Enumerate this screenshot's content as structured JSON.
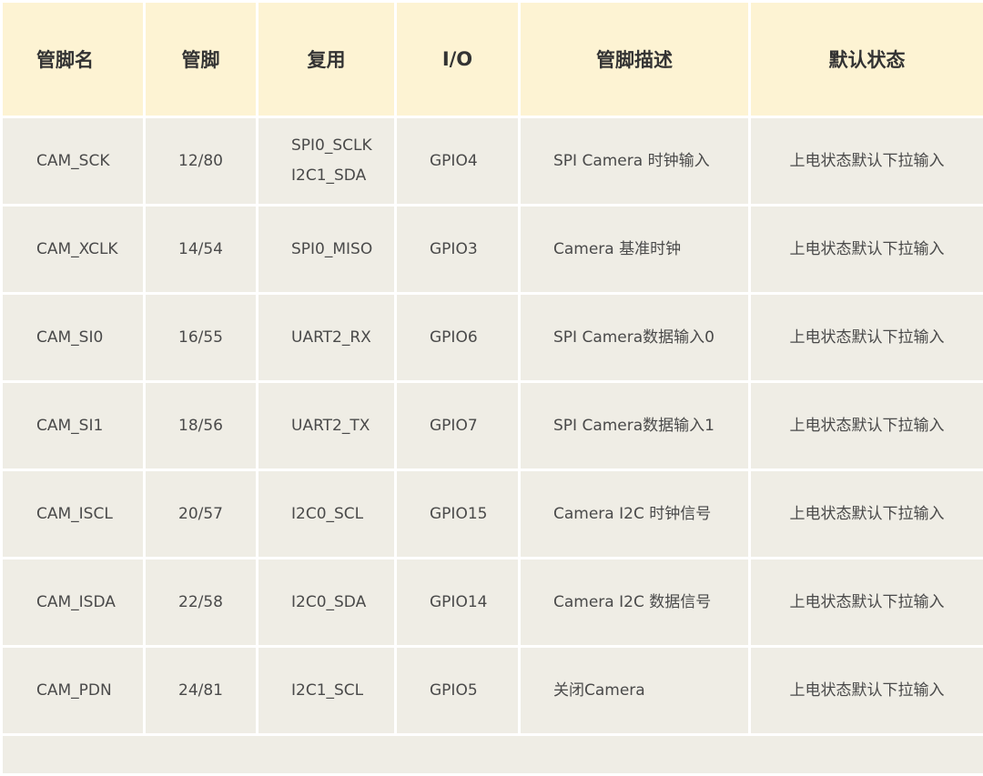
{
  "table": {
    "headers": [
      "管脚名",
      "管脚",
      "复用",
      "I/O",
      "管脚描述",
      "默认状态"
    ],
    "rows": [
      {
        "name": "CAM_SCK",
        "pin": "12/80",
        "mux": [
          "SPI0_SCLK",
          "I2C1_SDA"
        ],
        "io": "GPIO4",
        "desc": "SPI Camera 时钟输入",
        "default": "上电状态默认下拉输入"
      },
      {
        "name": "CAM_XCLK",
        "pin": "14/54",
        "mux": [
          "SPI0_MISO"
        ],
        "io": "GPIO3",
        "desc": "Camera 基准时钟",
        "default": "上电状态默认下拉输入"
      },
      {
        "name": "CAM_SI0",
        "pin": "16/55",
        "mux": [
          "UART2_RX"
        ],
        "io": "GPIO6",
        "desc": "SPI Camera数据输入0",
        "default": "上电状态默认下拉输入"
      },
      {
        "name": "CAM_SI1",
        "pin": "18/56",
        "mux": [
          "UART2_TX"
        ],
        "io": "GPIO7",
        "desc": "SPI Camera数据输入1",
        "default": "上电状态默认下拉输入"
      },
      {
        "name": "CAM_ISCL",
        "pin": "20/57",
        "mux": [
          "I2C0_SCL"
        ],
        "io": "GPIO15",
        "desc": "Camera I2C 时钟信号",
        "default": "上电状态默认下拉输入"
      },
      {
        "name": "CAM_ISDA",
        "pin": "22/58",
        "mux": [
          "I2C0_SDA"
        ],
        "io": "GPIO14",
        "desc": "Camera I2C 数据信号",
        "default": "上电状态默认下拉输入"
      },
      {
        "name": "CAM_PDN",
        "pin": "24/81",
        "mux": [
          "I2C1_SCL"
        ],
        "io": "GPIO5",
        "desc": "关闭Camera",
        "default": "上电状态默认下拉输入"
      }
    ]
  },
  "colors": {
    "header_bg": "#fdf3d3",
    "body_bg": "#efede5",
    "grid_line": "#ffffff"
  }
}
